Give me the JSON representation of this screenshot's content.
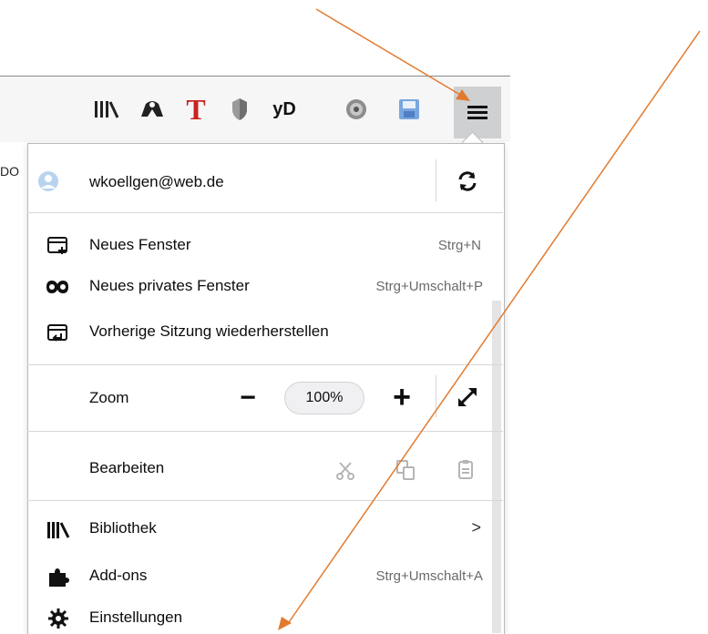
{
  "page_fragment": "DO",
  "toolbar": {
    "icons": [
      "library-icon",
      "pocket-icon",
      "t-extension-icon",
      "shield-icon",
      "yd-extension-icon",
      "gear-icon",
      "save-icon"
    ],
    "yd_label": "yD",
    "t_label": "T"
  },
  "account": {
    "email": "wkoellgen@web.de"
  },
  "menu": {
    "new_window": {
      "label": "Neues Fenster",
      "shortcut": "Strg+N"
    },
    "private_window": {
      "label": "Neues privates Fenster",
      "shortcut": "Strg+Umschalt+P"
    },
    "restore_session": {
      "label": "Vorherige Sitzung wiederherstellen"
    },
    "zoom": {
      "label": "Zoom",
      "value": "100%",
      "minus": "−",
      "plus": "+"
    },
    "edit": {
      "label": "Bearbeiten"
    },
    "library": {
      "label": "Bibliothek",
      "chevron": ">"
    },
    "addons": {
      "label": "Add-ons",
      "shortcut": "Strg+Umschalt+A"
    },
    "settings": {
      "label": "Einstellungen"
    }
  },
  "annotations": {
    "arrow_color": "#e27a2e"
  }
}
